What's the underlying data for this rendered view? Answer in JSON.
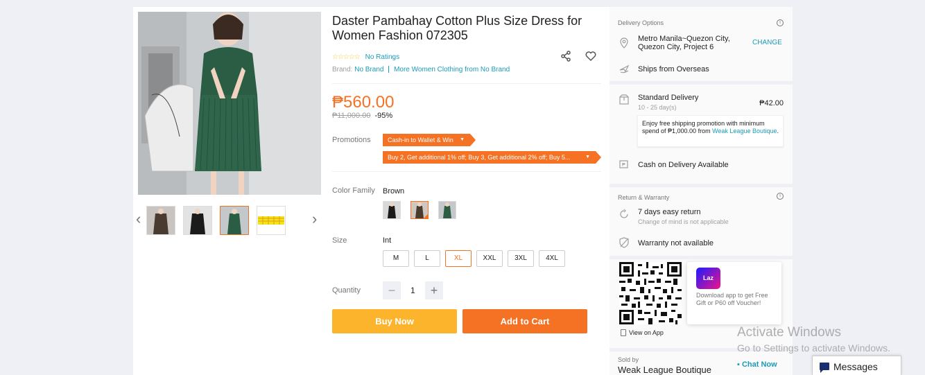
{
  "product": {
    "title": "Daster Pambahay Cotton Plus Size Dress for Women Fashion 072305",
    "stars": "☆☆☆☆☆",
    "ratings": "No Ratings",
    "brand_label": "Brand:",
    "brand_name": "No Brand",
    "more_link": "More Women Clothing from No Brand",
    "price": "₱560.00",
    "original_price": "₱11,000.00",
    "discount": "-95%"
  },
  "promotions": {
    "label": "Promotions",
    "items": [
      "Cash-in to Wallet & Win",
      "Buy 2, Get additional 1% off; Buy 3, Get additional 2% off; Buy 5..."
    ]
  },
  "color_family": {
    "label": "Color Family",
    "selected": "Brown",
    "options": [
      "Black",
      "Brown",
      "Green"
    ]
  },
  "size": {
    "label": "Size",
    "system": "Int",
    "options": [
      "M",
      "L",
      "XL",
      "XXL",
      "3XL",
      "4XL"
    ],
    "selected": "XL"
  },
  "quantity": {
    "label": "Quantity",
    "value": "1",
    "minus": "−",
    "plus": "+"
  },
  "actions": {
    "buy_now": "Buy Now",
    "add_to_cart": "Add to Cart"
  },
  "gallery": {
    "prev": "‹",
    "next": "›"
  },
  "delivery": {
    "title": "Delivery Options",
    "location": "Metro Manila~Quezon City, Quezon City, Project 6",
    "change": "CHANGE",
    "ships_from": "Ships from Overseas",
    "standard": "Standard Delivery",
    "standard_days": "10 - 25 day(s)",
    "standard_price": "₱42.00",
    "free_shipping_text": "Enjoy free shipping promotion with minimum spend of ₱1,000.00 from ",
    "store_link": "Weak League Boutique",
    "cod": "Cash on Delivery Available"
  },
  "warranty": {
    "title": "Return & Warranty",
    "return": "7 days easy return",
    "return_sub": "Change of mind is not applicable",
    "warranty": "Warranty not available"
  },
  "app_promo": {
    "logo": "Laz",
    "text": "Download app to get Free Gift or P60 off Voucher!",
    "view_on_app": "View on App"
  },
  "seller": {
    "label": "Sold by",
    "name": "Weak League Boutique",
    "chat": "Chat Now"
  },
  "overlay": {
    "activate_title": "Activate Windows",
    "activate_sub": "Go to Settings to activate Windows.",
    "messages": "Messages"
  },
  "colors": {
    "accent": "#f57224",
    "buy": "#fcb42d",
    "link": "#1a9cb7"
  }
}
